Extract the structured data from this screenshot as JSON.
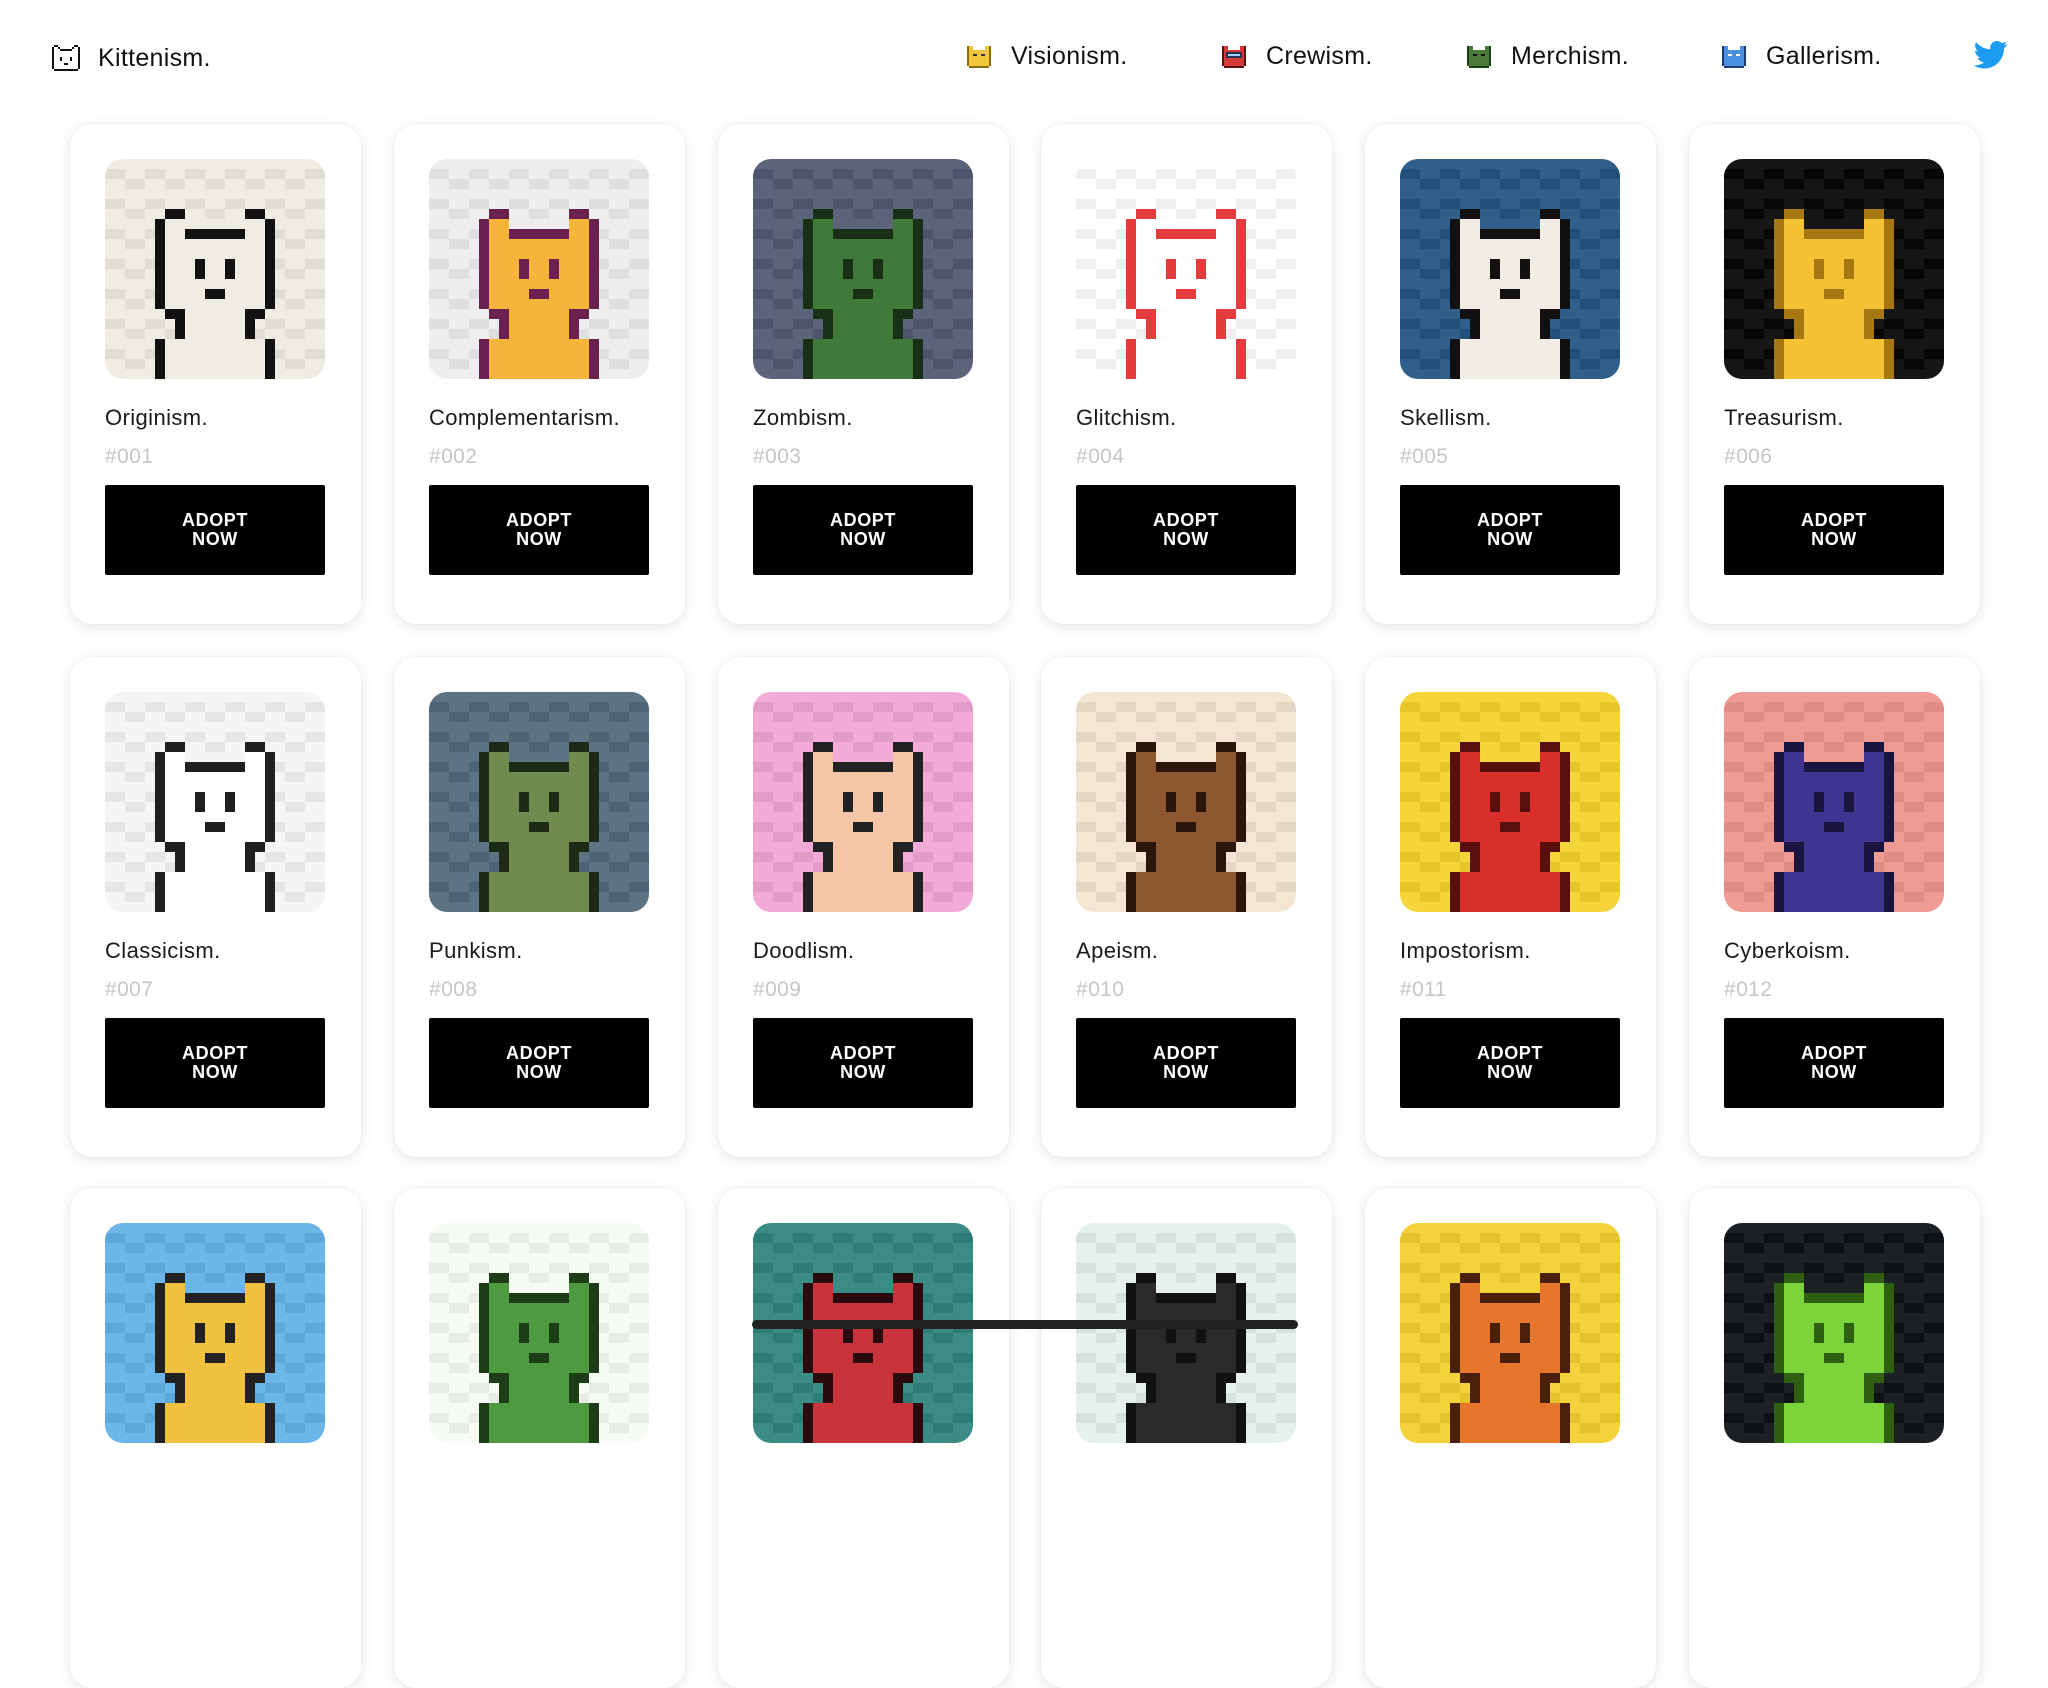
{
  "header": {
    "brand": {
      "label": "Kittenism.",
      "icon": "cat-outline-icon"
    },
    "nav": [
      {
        "label": "Visionism.",
        "icon": "yellow-cat-icon",
        "color": "#f3c63b"
      },
      {
        "label": "Crewism.",
        "icon": "red-cat-icon",
        "color": "#d33a3a"
      },
      {
        "label": "Merchism.",
        "icon": "green-cat-icon",
        "color": "#4c7a3a"
      },
      {
        "label": "Gallerism.",
        "icon": "blue-cat-icon",
        "color": "#4b8fe0"
      }
    ],
    "twitter_icon": "twitter-icon"
  },
  "cards": [
    {
      "title": "Originism.",
      "number": "#001",
      "button": "ADOPT\nNOW",
      "bg": "#efede1",
      "fur": "#efede1",
      "outline": "#111111"
    },
    {
      "title": "Complementarism.",
      "number": "#002",
      "button": "ADOPT\nNOW",
      "bg": "#eeeeee",
      "fur": "#f6b53a",
      "outline": "#6b2050"
    },
    {
      "title": "Zombism.",
      "number": "#003",
      "button": "ADOPT\nNOW",
      "bg": "#5c6479",
      "fur": "#3f7a3a",
      "outline": "#173016"
    },
    {
      "title": "Glitchism.",
      "number": "#004",
      "button": "ADOPT\nNOW",
      "bg": "#ffffff",
      "fur": "#ffffff",
      "outline": "#e23c3c"
    },
    {
      "title": "Skellism.",
      "number": "#005",
      "button": "ADOPT\nNOW",
      "bg": "#2f5f8a",
      "fur": "#f2ede2",
      "outline": "#111111"
    },
    {
      "title": "Treasurism.",
      "number": "#006",
      "button": "ADOPT\nNOW",
      "bg": "#151515",
      "fur": "#f4c233",
      "outline": "#a77812"
    },
    {
      "title": "Classicism.",
      "number": "#007",
      "button": "ADOPT\nNOW",
      "bg": "#f5f5f5",
      "fur": "#ffffff",
      "outline": "#1f1f1f"
    },
    {
      "title": "Punkism.",
      "number": "#008",
      "button": "ADOPT\nNOW",
      "bg": "#5c7384",
      "fur": "#6f8c4e",
      "outline": "#1d2b16"
    },
    {
      "title": "Doodlism.",
      "number": "#009",
      "button": "ADOPT\nNOW",
      "bg": "#f2aad7",
      "fur": "#f5c7a6",
      "outline": "#222222"
    },
    {
      "title": "Apeism.",
      "number": "#010",
      "button": "ADOPT\nNOW",
      "bg": "#f5e6d3",
      "fur": "#8d5830",
      "outline": "#2a160a"
    },
    {
      "title": "Impostorism.",
      "number": "#011",
      "button": "ADOPT\nNOW",
      "bg": "#f5d53a",
      "fur": "#d9302a",
      "outline": "#5a0f0f"
    },
    {
      "title": "Cyberkoism.",
      "number": "#012",
      "button": "ADOPT\nNOW",
      "bg": "#ef9a92",
      "fur": "#3f3590",
      "outline": "#1a1440"
    },
    {
      "title": "",
      "number": "",
      "button": "",
      "bg": "#6cb6ea",
      "fur": "#f1c13f",
      "outline": "#222222"
    },
    {
      "title": "",
      "number": "",
      "button": "",
      "bg": "#f6fbf3",
      "fur": "#4d9a40",
      "outline": "#1d3d17"
    },
    {
      "title": "",
      "number": "",
      "button": "",
      "bg": "#3a8c84",
      "fur": "#c9343c",
      "outline": "#2a0a0c"
    },
    {
      "title": "",
      "number": "",
      "button": "",
      "bg": "#e5f2ec",
      "fur": "#2a2a2a",
      "outline": "#111111"
    },
    {
      "title": "",
      "number": "",
      "button": "",
      "bg": "#f5d23a",
      "fur": "#e6762b",
      "outline": "#4a2008"
    },
    {
      "title": "",
      "number": "",
      "button": "",
      "bg": "#1c2024",
      "fur": "#7bd43a",
      "outline": "#2f5f10"
    }
  ]
}
